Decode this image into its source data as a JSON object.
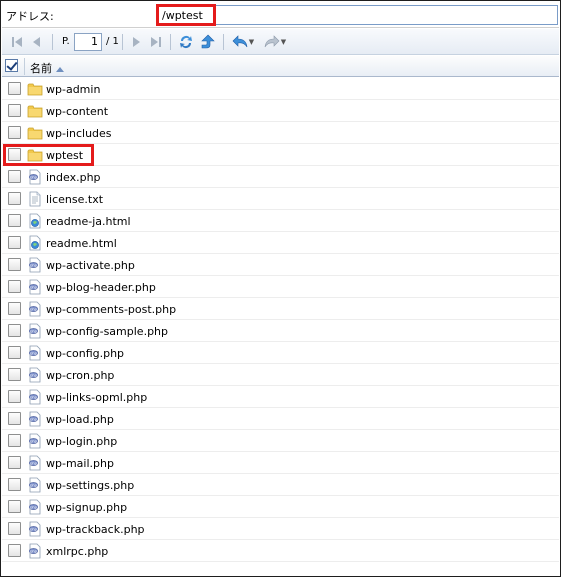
{
  "address_bar": {
    "label": "アドレス:",
    "value": "/wptest"
  },
  "toolbar": {
    "page_prefix": "P.",
    "current_page": "1",
    "page_total": "/ 1"
  },
  "grid": {
    "name_header": "名前",
    "rows": [
      {
        "name": "wp-admin",
        "icon": "folder-icon"
      },
      {
        "name": "wp-content",
        "icon": "folder-icon"
      },
      {
        "name": "wp-includes",
        "icon": "folder-icon"
      },
      {
        "name": "wptest",
        "icon": "folder-icon"
      },
      {
        "name": "index.php",
        "icon": "php-file-icon"
      },
      {
        "name": "license.txt",
        "icon": "text-file-icon"
      },
      {
        "name": "readme-ja.html",
        "icon": "html-file-icon"
      },
      {
        "name": "readme.html",
        "icon": "html-file-icon"
      },
      {
        "name": "wp-activate.php",
        "icon": "php-file-icon"
      },
      {
        "name": "wp-blog-header.php",
        "icon": "php-file-icon"
      },
      {
        "name": "wp-comments-post.php",
        "icon": "php-file-icon"
      },
      {
        "name": "wp-config-sample.php",
        "icon": "php-file-icon"
      },
      {
        "name": "wp-config.php",
        "icon": "php-file-icon"
      },
      {
        "name": "wp-cron.php",
        "icon": "php-file-icon"
      },
      {
        "name": "wp-links-opml.php",
        "icon": "php-file-icon"
      },
      {
        "name": "wp-load.php",
        "icon": "php-file-icon"
      },
      {
        "name": "wp-login.php",
        "icon": "php-file-icon"
      },
      {
        "name": "wp-mail.php",
        "icon": "php-file-icon"
      },
      {
        "name": "wp-settings.php",
        "icon": "php-file-icon"
      },
      {
        "name": "wp-signup.php",
        "icon": "php-file-icon"
      },
      {
        "name": "wp-trackback.php",
        "icon": "php-file-icon"
      },
      {
        "name": "xmlrpc.php",
        "icon": "php-file-icon"
      }
    ]
  },
  "colors": {
    "highlight": "#e41b1b",
    "folder": "#f2c94c",
    "accent": "#2b6fc2"
  }
}
